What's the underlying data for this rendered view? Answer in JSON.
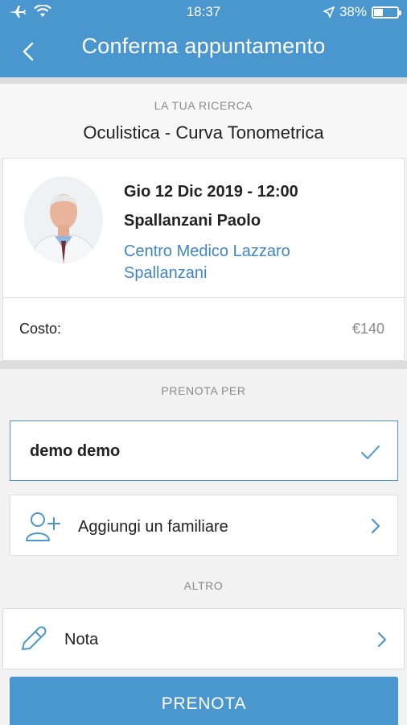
{
  "status_bar": {
    "time": "18:37",
    "battery": "38%",
    "battery_level": 0.38
  },
  "nav": {
    "title": "Conferma appuntamento"
  },
  "search": {
    "label": "LA TUA RICERCA",
    "value": "Oculistica - Curva Tonometrica"
  },
  "appointment": {
    "datetime": "Gio 12 Dic 2019 - 12:00",
    "doctor": "Spallanzani Paolo",
    "clinic": "Centro Medico Lazzaro Spallanzani"
  },
  "cost": {
    "label": "Costo:",
    "value": "€140"
  },
  "book_for": {
    "label": "PRENOTA PER",
    "selected": "demo demo",
    "add_family": "Aggiungi un familiare"
  },
  "other": {
    "label": "ALTRO",
    "note": "Nota"
  },
  "actions": {
    "book": "PRENOTA"
  },
  "colors": {
    "primary": "#4a97cf",
    "link": "#3f86c9"
  }
}
